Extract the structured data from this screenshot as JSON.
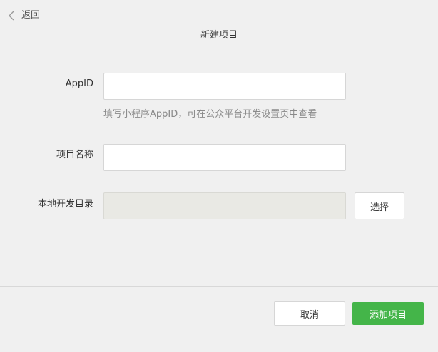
{
  "header": {
    "back_label": "返回",
    "title": "新建项目"
  },
  "form": {
    "appid": {
      "label": "AppID",
      "value": "",
      "hint": "填写小程序AppID，可在公众平台开发设置页中查看"
    },
    "project_name": {
      "label": "项目名称",
      "value": ""
    },
    "local_dir": {
      "label": "本地开发目录",
      "value": "",
      "choose_label": "选择"
    }
  },
  "footer": {
    "cancel_label": "取消",
    "add_label": "添加项目"
  },
  "colors": {
    "background": "#f0f0f0",
    "primary": "#44b549",
    "disabled_input": "#e9e9e4"
  }
}
